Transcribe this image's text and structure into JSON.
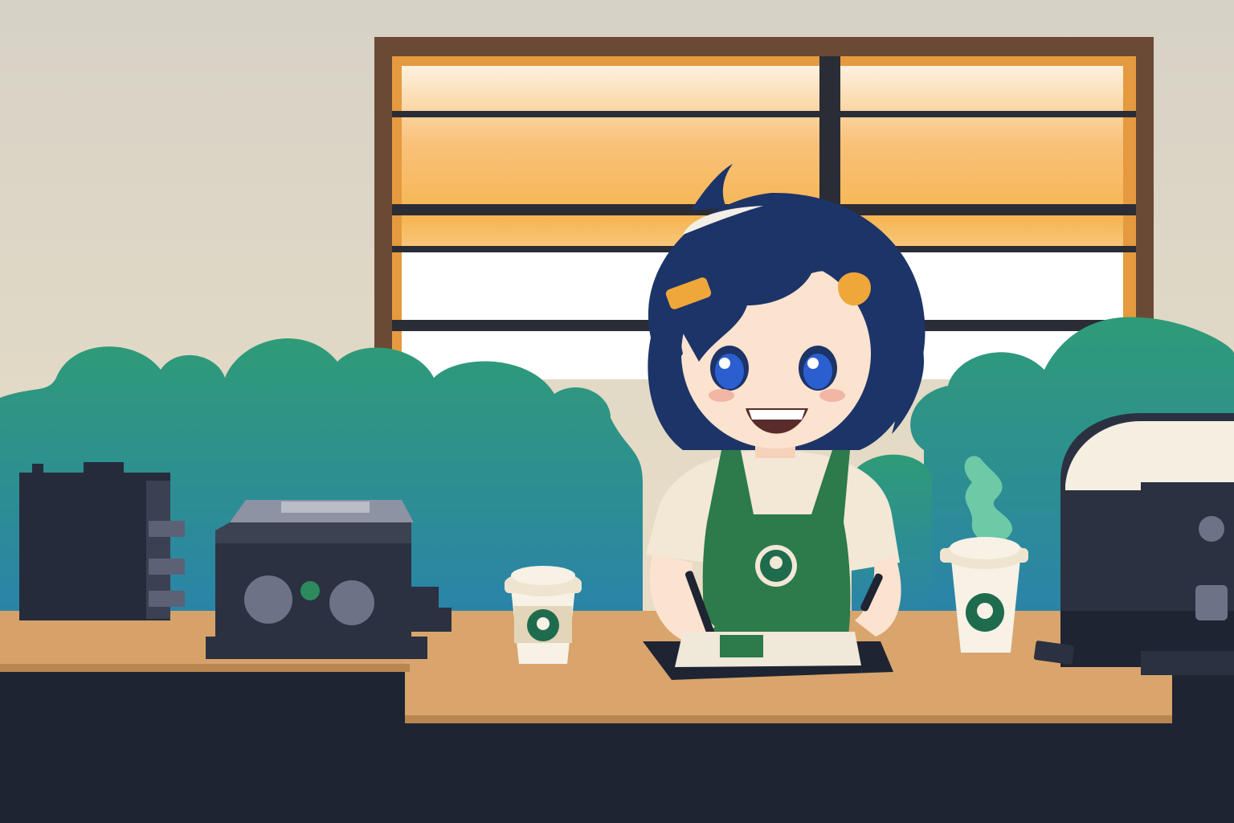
{
  "scene": {
    "description_hidden": "",
    "colors": {
      "wall_top": "#d9d4c7",
      "wall_bottom": "#efe2c8",
      "window_frame": "#6b4a35",
      "window_glass_top": "#fdf0dc",
      "window_glass_mid": "#f6b552",
      "window_glass_bottom": "#ffffff",
      "bushes_top": "#2f9a7a",
      "bushes_bottom": "#2a87a5",
      "counter_top": "#d9a56d",
      "counter_front": "#1f2433",
      "apron": "#2d7a4a",
      "hair": "#1d3468",
      "shirt": "#f3e7d6",
      "skin": "#fbe3cf",
      "eye": "#2b5fd0",
      "steam": "#6ec9a6",
      "machine": "#2b3140",
      "machine_light": "#3a3f4f",
      "cup": "#f7f1e6",
      "cup_lid": "#efe4cf",
      "logo_green": "#1f6b4d",
      "hair_clip": "#f0a73a"
    },
    "icons": [
      "coffee-cup-icon",
      "espresso-machine-icon",
      "siren-logo-icon",
      "drawing-tablet-icon",
      "stylus-icon"
    ]
  }
}
